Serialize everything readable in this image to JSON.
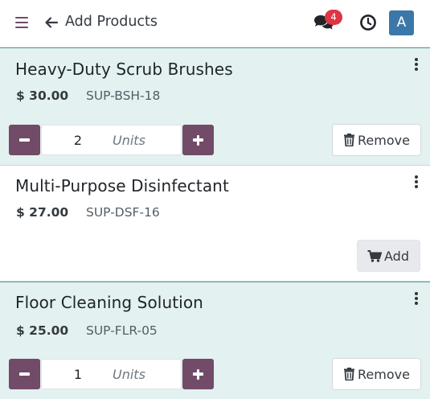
{
  "header": {
    "title": "Add Products",
    "notification_count": "4",
    "avatar_letter": "A"
  },
  "colors": {
    "primary": "#714b67",
    "selected_bg": "#e3f1f1",
    "badge": "#dc3545",
    "avatar": "#3b77a8"
  },
  "icons": [
    "hamburger-menu-icon",
    "back-arrow-icon",
    "chat-icon",
    "clock-icon",
    "kebab-menu-icon",
    "trash-icon",
    "cart-icon",
    "minus-icon",
    "plus-icon"
  ],
  "products": [
    {
      "name": "Heavy-Duty Scrub Brushes",
      "price": "$ 30.00",
      "sku": "SUP-BSH-18",
      "selected": true,
      "quantity": "2",
      "unit": "Units",
      "action_label": "Remove"
    },
    {
      "name": "Multi-Purpose Disinfectant",
      "price": "$ 27.00",
      "sku": "SUP-DSF-16",
      "selected": false,
      "action_label": "Add"
    },
    {
      "name": "Floor Cleaning Solution",
      "price": "$ 25.00",
      "sku": "SUP-FLR-05",
      "selected": true,
      "quantity": "1",
      "unit": "Units",
      "action_label": "Remove"
    }
  ]
}
